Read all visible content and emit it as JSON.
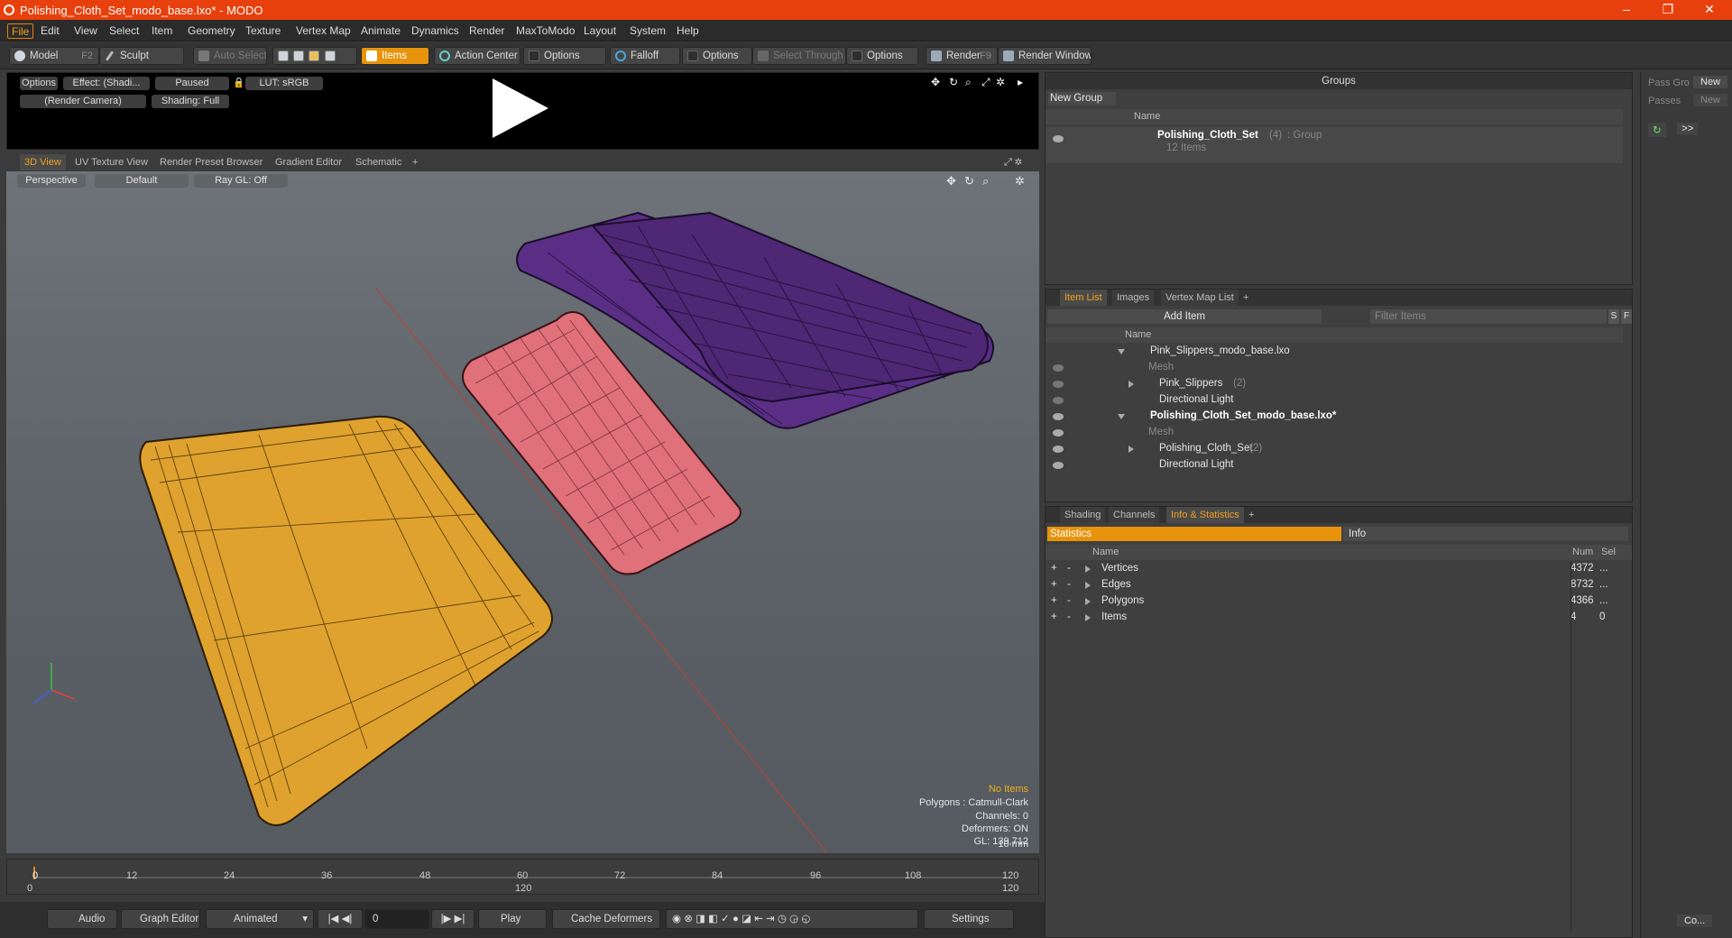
{
  "window": {
    "title": "Polishing_Cloth_Set_modo_base.lxo* - MODO",
    "minimize": "–",
    "restore": "❐",
    "close": "✕"
  },
  "menu": [
    "File",
    "Edit",
    "View",
    "Select",
    "Item",
    "Geometry",
    "Texture",
    "Vertex Map",
    "Animate",
    "Dynamics",
    "Render",
    "MaxToModo",
    "Layout",
    "System",
    "Help"
  ],
  "toolbar": {
    "model": "Model",
    "model_key": "F2",
    "sculpt": "Sculpt",
    "auto_select": "Auto Select",
    "items": "Items",
    "action_center": "Action Center",
    "options1": "Options",
    "falloff": "Falloff",
    "options2": "Options",
    "select_through": "Select Through",
    "options3": "Options",
    "render": "Render",
    "render_key": "F9",
    "render_window": "Render Window"
  },
  "preview": {
    "options": "Options",
    "effect": "Effect: (Shadi...",
    "paused": "Paused",
    "lut": "LUT: sRGB",
    "camera": "(Render Camera)",
    "shading": "Shading: Full"
  },
  "view_tabs": [
    "3D View",
    "UV Texture View",
    "Render Preset Browser",
    "Gradient Editor",
    "Schematic",
    "+"
  ],
  "viewport": {
    "perspective": "Perspective",
    "default": "Default",
    "raygl": "Ray GL: Off",
    "stats": {
      "no_items": "No Items",
      "polygons": "Polygons : Catmull-Clark",
      "channels": "Channels: 0",
      "deformers": "Deformers: ON",
      "gl": "GL: 139,712",
      "scale": "10 mm"
    }
  },
  "timeline": {
    "top_ticks": [
      "0",
      "12",
      "24",
      "36",
      "48",
      "60",
      "72",
      "84",
      "96",
      "108",
      "120"
    ],
    "bottom_left": "0",
    "bottom_mid": "120",
    "bottom_right": "120"
  },
  "bottombar": {
    "audio": "Audio",
    "graph_editor": "Graph Editor",
    "animated": "Animated",
    "frame": "0",
    "play": "Play",
    "cache": "Cache Deformers",
    "settings": "Settings"
  },
  "groups": {
    "title": "Groups",
    "new_group": "New Group",
    "col_name": "Name",
    "row_name": "Polishing_Cloth_Set",
    "row_count": "(4)",
    "row_type": ": Group",
    "row_items": "12 Items"
  },
  "passes": {
    "pass_group": "Pass Gro",
    "new1": "New",
    "passes": "Passes",
    "new2": "New",
    "btn": ">>",
    "co": "Co..."
  },
  "itemlist": {
    "tabs": [
      "Item List",
      "Images",
      "Vertex Map List",
      "+"
    ],
    "add_item": "Add Item",
    "filter": "Filter Items",
    "s": "S",
    "f": "F",
    "col_name": "Name",
    "rows": [
      {
        "label": "Pink_Slippers_modo_base.lxo",
        "extra": ""
      },
      {
        "label": "Mesh",
        "extra": ""
      },
      {
        "label": "Pink_Slippers",
        "extra": "(2)"
      },
      {
        "label": "Directional Light",
        "extra": ""
      },
      {
        "label": "Polishing_Cloth_Set_modo_base.lxo*",
        "extra": ""
      },
      {
        "label": "Mesh",
        "extra": ""
      },
      {
        "label": "Polishing_Cloth_Set",
        "extra": "(2)"
      },
      {
        "label": "Directional Light",
        "extra": ""
      }
    ]
  },
  "stats": {
    "tabs": [
      "Shading",
      "Channels",
      "Info & Statistics",
      "+"
    ],
    "statistics": "Statistics",
    "info": "Info",
    "cols": {
      "name": "Name",
      "num": "Num",
      "sel": "Sel"
    },
    "rows": [
      {
        "name": "Vertices",
        "num": "4372",
        "sel": "..."
      },
      {
        "name": "Edges",
        "num": "8732",
        "sel": "..."
      },
      {
        "name": "Polygons",
        "num": "4366",
        "sel": "..."
      },
      {
        "name": "Items",
        "num": "4",
        "sel": "0"
      }
    ]
  },
  "colors": {
    "accent": "#e8930c",
    "titlebar": "#e8400c",
    "cloth_yellow": "#e0a22e",
    "cloth_pink": "#e0707a",
    "cloth_purple": "#5b2e86"
  }
}
